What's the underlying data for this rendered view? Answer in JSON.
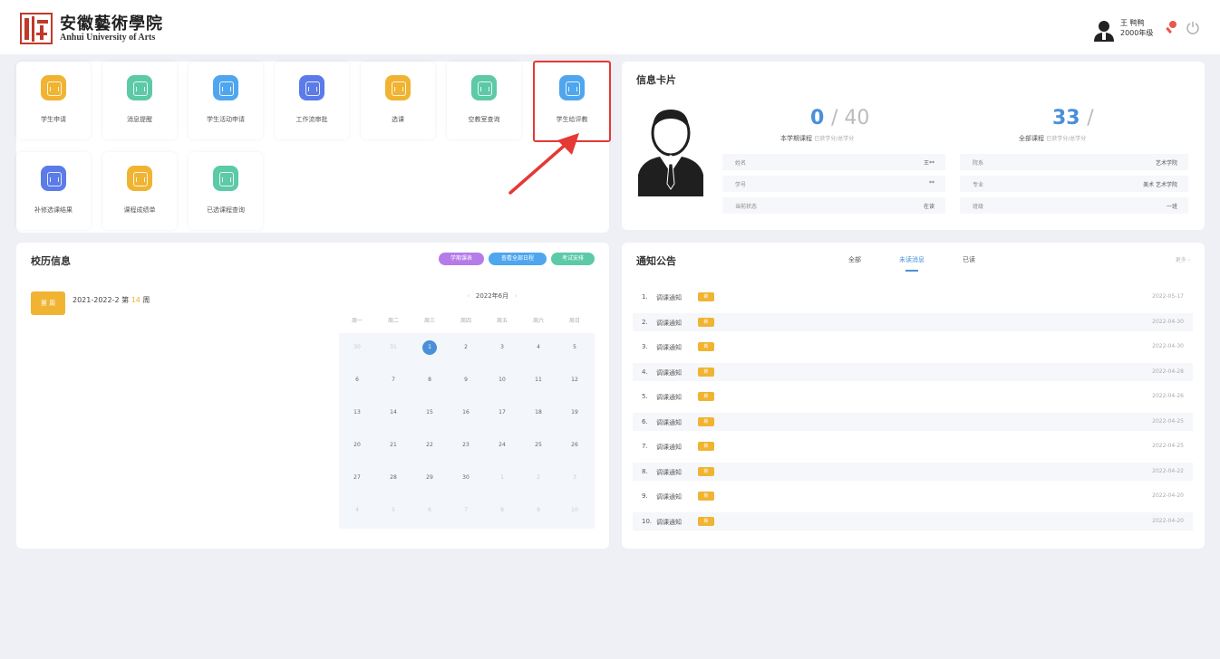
{
  "header": {
    "logo_text_cn": "安徽藝術學院",
    "logo_text_en": "Anhui University of Arts",
    "user_line1": "王 鸭鸭",
    "user_line2": "2000年级"
  },
  "apps": {
    "tiles": [
      {
        "label": "学生申请",
        "color": "#f0b432"
      },
      {
        "label": "消息提醒",
        "color": "#5cc9a7"
      },
      {
        "label": "学生活动申请",
        "color": "#4fa6ee"
      },
      {
        "label": "工作流审批",
        "color": "#5b7be8"
      },
      {
        "label": "选课",
        "color": "#f0b432"
      },
      {
        "label": "空教室查询",
        "color": "#5cc9a7"
      },
      {
        "label": "学生给评教",
        "color": "#4fa6ee"
      },
      {
        "label": "补修选课结果",
        "color": "#5b7be8"
      },
      {
        "label": "课程成绩单",
        "color": "#f0b432"
      },
      {
        "label": "已选课程查询",
        "color": "#5cc9a7"
      }
    ]
  },
  "info_card": {
    "title": "信息卡片",
    "left_value": "0",
    "left_total": "/ 40",
    "left_label": "本学期课程",
    "left_sub": "已获学分/总学分",
    "right_value": "33",
    "right_total": "/",
    "right_label": "全部课程",
    "right_sub": "已获学分/总学分",
    "rows_left": [
      {
        "k": "姓名",
        "v": "王**"
      },
      {
        "k": "学号",
        "v": "**"
      },
      {
        "k": "当前状态",
        "v": "在读"
      }
    ],
    "rows_right": [
      {
        "k": "院系",
        "v": "艺术学院"
      },
      {
        "k": "专业",
        "v": "美术 艺术学院"
      },
      {
        "k": "班级",
        "v": "一班"
      }
    ]
  },
  "calendar": {
    "title": "校历信息",
    "tags": [
      {
        "label": "学期课表",
        "color": "#b57be8"
      },
      {
        "label": "查看全部日程",
        "color": "#4fa6ee"
      },
      {
        "label": "考试安排",
        "color": "#5cc9a7"
      }
    ],
    "week_box": "第 周",
    "term": "2021-2022-2",
    "week_prefix": "第",
    "week_num": "14",
    "week_suffix": "周",
    "month_label": "2022年6月",
    "prev": "‹",
    "next": "›",
    "dow": [
      "周一",
      "周二",
      "周三",
      "周四",
      "周五",
      "周六",
      "周日"
    ],
    "days": [
      [
        "30",
        "31",
        "1",
        "2",
        "3",
        "4",
        "5"
      ],
      [
        "6",
        "7",
        "8",
        "9",
        "10",
        "11",
        "12"
      ],
      [
        "13",
        "14",
        "15",
        "16",
        "17",
        "18",
        "19"
      ],
      [
        "20",
        "21",
        "22",
        "23",
        "24",
        "25",
        "26"
      ],
      [
        "27",
        "28",
        "29",
        "30",
        "1",
        "2",
        "3"
      ],
      [
        "4",
        "5",
        "6",
        "7",
        "8",
        "9",
        "10"
      ]
    ],
    "today": "1"
  },
  "notices": {
    "title": "通知公告",
    "tabs": [
      "全部",
      "未读消息",
      "已读"
    ],
    "active_tab": 1,
    "more": "更多 ›",
    "items": [
      {
        "idx": "1.",
        "title": "调课通知",
        "badge": "新",
        "date": "2022-05-17"
      },
      {
        "idx": "2.",
        "title": "调课通知",
        "badge": "新",
        "date": "2022-04-30"
      },
      {
        "idx": "3.",
        "title": "调课通知",
        "badge": "新",
        "date": "2022-04-30"
      },
      {
        "idx": "4.",
        "title": "调课通知",
        "badge": "新",
        "date": "2022-04-28"
      },
      {
        "idx": "5.",
        "title": "调课通知",
        "badge": "新",
        "date": "2022-04-26"
      },
      {
        "idx": "6.",
        "title": "调课通知",
        "badge": "新",
        "date": "2022-04-25"
      },
      {
        "idx": "7.",
        "title": "调课通知",
        "badge": "新",
        "date": "2022-04-25"
      },
      {
        "idx": "8.",
        "title": "调课通知",
        "badge": "新",
        "date": "2022-04-22"
      },
      {
        "idx": "9.",
        "title": "调课通知",
        "badge": "新",
        "date": "2022-04-20"
      },
      {
        "idx": "10.",
        "title": "调课通知",
        "badge": "新",
        "date": "2022-04-20"
      }
    ]
  }
}
